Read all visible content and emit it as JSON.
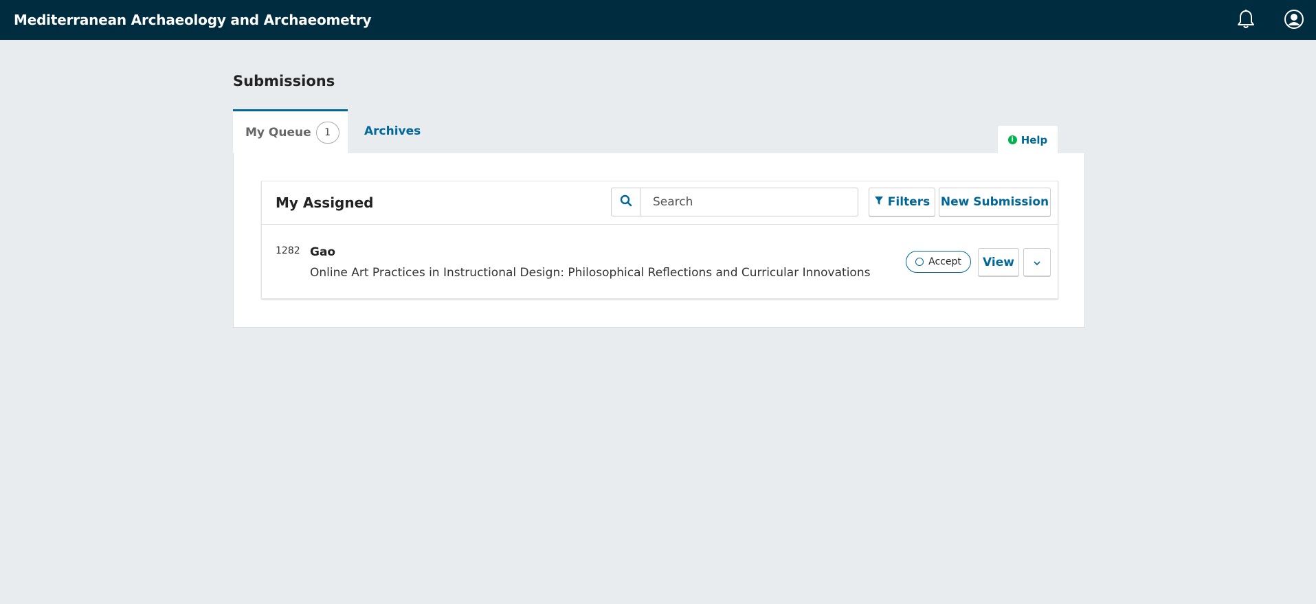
{
  "header": {
    "site_title": "Mediterranean Archaeology and Archaeometry",
    "icons": [
      "bell-icon",
      "user-icon"
    ]
  },
  "page": {
    "title": "Submissions"
  },
  "tabs": [
    {
      "label": "My Queue",
      "count": "1",
      "active": true
    },
    {
      "label": "Archives",
      "active": false
    }
  ],
  "help": {
    "label": "Help",
    "icon": "info-icon"
  },
  "list": {
    "title": "My Assigned",
    "search": {
      "placeholder": "Search",
      "value": ""
    },
    "filters_label": "Filters",
    "new_submission_label": "New Submission",
    "items": [
      {
        "id": "1282",
        "author": "Gao",
        "title": "Online Art Practices in Instructional Design: Philosophical Reflections and Curricular Innovations",
        "status": "Accept",
        "view_label": "View"
      }
    ]
  },
  "colors": {
    "header_bg": "#002c40",
    "accent": "#006798",
    "help_icon": "#00b24e",
    "page_bg": "#e9ecee"
  }
}
